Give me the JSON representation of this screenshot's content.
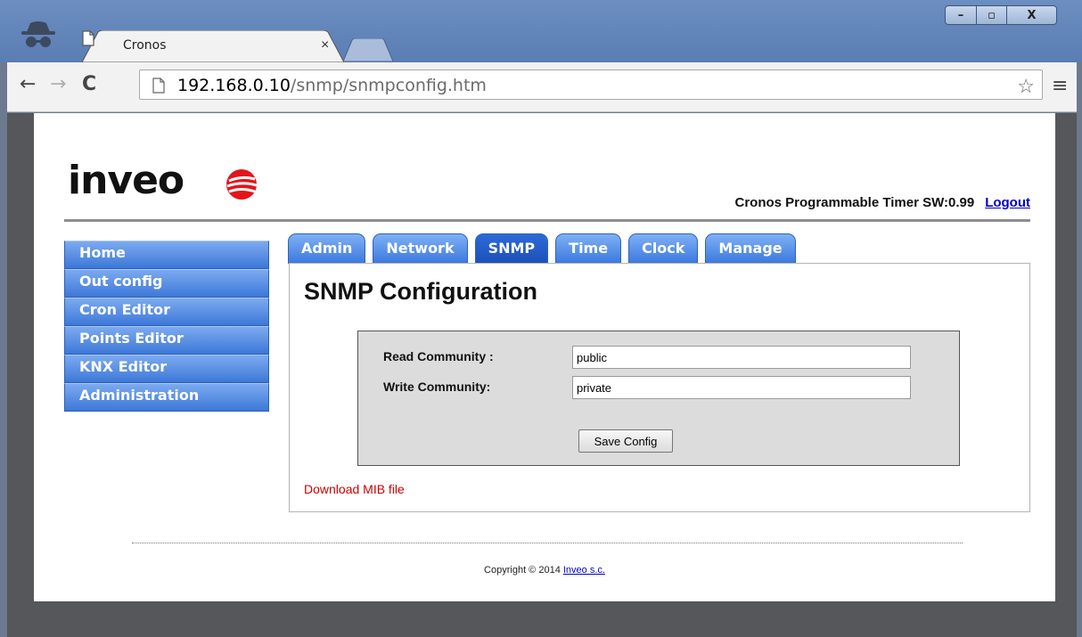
{
  "browser": {
    "tab_title": "Cronos",
    "tab_close": "×",
    "url_host": "192.168.0.10",
    "url_path": "/snmp/snmpconfig.htm",
    "back_glyph": "←",
    "forward_glyph": "→",
    "reload_glyph": "C",
    "star_glyph": "☆",
    "menu_glyph": "≡",
    "window_controls": {
      "minimize": "–",
      "maximize": "▫",
      "close": "X"
    }
  },
  "header": {
    "logo_text": "inveo",
    "device_info": "Cronos Programmable Timer SW:0.99",
    "logout_label": "Logout"
  },
  "sidemenu": {
    "items": [
      {
        "label": "Home"
      },
      {
        "label": "Out config"
      },
      {
        "label": "Cron Editor"
      },
      {
        "label": "Points Editor"
      },
      {
        "label": "KNX Editor"
      },
      {
        "label": "Administration"
      }
    ]
  },
  "tabs": {
    "items": [
      {
        "label": "Admin"
      },
      {
        "label": "Network"
      },
      {
        "label": "SNMP"
      },
      {
        "label": "Time"
      },
      {
        "label": "Clock"
      },
      {
        "label": "Manage"
      }
    ],
    "active": "SNMP"
  },
  "main": {
    "title": "SNMP Configuration",
    "read_label": "Read Community :",
    "read_value": "public",
    "write_label": "Write Community:",
    "write_value": "private",
    "save_label": "Save Config",
    "mib_link": "Download MIB file"
  },
  "footer": {
    "copyright": "Copyright © 2014",
    "company_link": "Inveo s.c."
  },
  "colors": {
    "menu_blue": "#3d78d8",
    "tab_active": "#1c50b8",
    "link_red": "#cc0000",
    "logo_red": "#e3151b"
  }
}
